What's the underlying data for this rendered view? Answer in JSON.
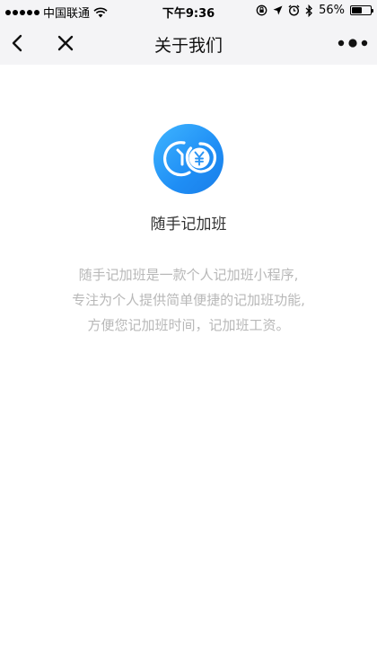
{
  "status_bar": {
    "carrier": "中国联通",
    "time": "下午9:36",
    "battery_percent": "56%",
    "battery_level": 0.56
  },
  "nav": {
    "title": "关于我们"
  },
  "app": {
    "name": "随手记加班",
    "logo_colors": [
      "#3fb5ff",
      "#1a7ee8"
    ]
  },
  "description": {
    "lines": [
      "随手记加班是一款个人记加班小程序,",
      "专注为个人提供简单便捷的记加班功能,",
      "方便您记加班时间，记加班工资。"
    ]
  },
  "icons": {
    "back": "chevron-left-icon",
    "close": "close-icon",
    "more": "more-dots-icon",
    "logo": "clock-yen-logo"
  }
}
